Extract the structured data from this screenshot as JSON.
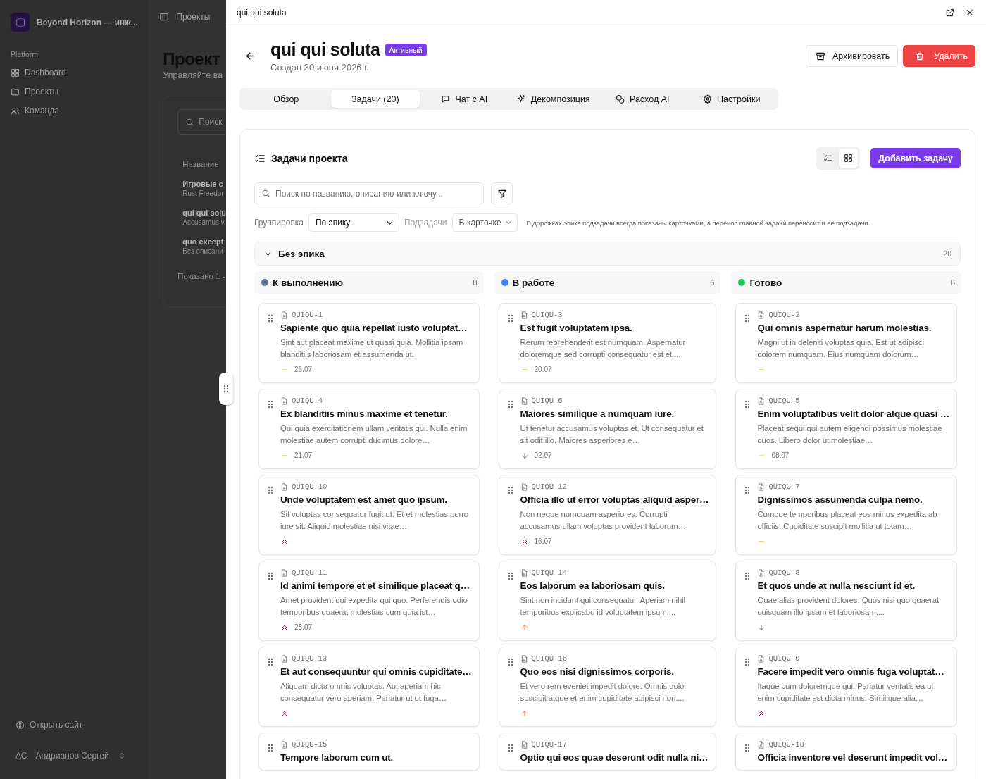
{
  "background": {
    "brand": "Beyond Horizon — инж...",
    "header_title": "Проекты",
    "section_label": "Platform",
    "nav": [
      {
        "label": "Dashboard"
      },
      {
        "label": "Проекты"
      },
      {
        "label": "Команда"
      }
    ],
    "open_site": "Открыть сайт",
    "user": {
      "initials": "АС",
      "name": "Андрианов Сергей"
    },
    "page_title": "Проект",
    "page_subtitle": "Управляйте ва",
    "search_placeholder": "Поиск",
    "column_header": "Название",
    "rows": [
      {
        "title": "Игровые с",
        "subtitle": "Rust Freedor"
      },
      {
        "title": "qui qui solu",
        "subtitle": "Accusamus v"
      },
      {
        "title": "quo except",
        "subtitle": "Без описани"
      }
    ],
    "footer": "Показано 1 -"
  },
  "drawer": {
    "title": "qui qui soluta"
  },
  "project": {
    "name": "qui qui soluta",
    "status": "Активный",
    "created": "Создан 30 июня 2026 г.",
    "archive_button": "Архивировать",
    "delete_button": "Удалить"
  },
  "tabs": [
    {
      "label": "Обзор",
      "selected": false
    },
    {
      "label": "Задачи (20)",
      "selected": true
    },
    {
      "label": "Чат с AI",
      "selected": false
    },
    {
      "label": "Декомпозиция",
      "selected": false
    },
    {
      "label": "Расход AI",
      "selected": false
    },
    {
      "label": "Настройки",
      "selected": false
    }
  ],
  "tasks_panel": {
    "title": "Задачи проекта",
    "views": [
      {
        "selected": false
      },
      {
        "selected": true
      }
    ],
    "add_button": "Добавить задачу",
    "search_placeholder": "Поиск по названию, описанию или ключу...",
    "grouping_label": "Группировка",
    "grouping_value": "По эпику",
    "subtasks_label": "Подзадачи",
    "subtasks_value": "В карточке",
    "hint": "В дорожках эпика подзадачи всегда показаны карточками, а перенос главной задачи переносит и её подзадачи.",
    "epic": {
      "name": "Без эпика",
      "count": "20",
      "expanded": true
    },
    "columns": [
      {
        "name": "К выполнению",
        "count": "8",
        "color": "#64748b",
        "cards": [
          {
            "key": "QUIQU-1",
            "title": "Sapiente quo quia repellat iusto voluptat…",
            "description": "Sint aut placeat maxime ut quasi quia. Mollitia ipsam blanditiis laboriosam et assumenda ut.",
            "kind": "medium",
            "date": "26.07"
          },
          {
            "key": "QUIQU-4",
            "title": "Ex blanditiis minus maxime et tenetur.",
            "description": "Qui quia exercitationem ullam veritatis qui. Nulla enim molestiae autem corrupti ducimus dolore…",
            "kind": "medium",
            "date": "21.07"
          },
          {
            "key": "QUIQU-10",
            "title": "Unde voluptatem est amet quo ipsum.",
            "description": "Sit voluptas consequatur fugit ut. Et et molestias porro iure sit. Aliquid molestiae nisi vitae…",
            "kind": "urgent"
          },
          {
            "key": "QUIQU-11",
            "title": "Id animi tempore et et similique placeat q…",
            "description": "Amet provident qui expedita qui quo. Perferendis odio temporibus quaerat molestias cum quia ist…",
            "kind": "urgent",
            "date": "28.07"
          },
          {
            "key": "QUIQU-13",
            "title": "Et aut consequuntur qui omnis cupiditate…",
            "description": "Aliquam dicta omnis voluptas. Aut aperiam hic consequatur vero aperiam. Pariatur ut ut fuga…",
            "kind": "urgent"
          },
          {
            "key": "QUIQU-15",
            "title": "Tempore laborum cum ut."
          }
        ]
      },
      {
        "name": "В работе",
        "count": "6",
        "color": "#3b82f6",
        "cards": [
          {
            "key": "QUIQU-3",
            "title": "Est fugit voluptatem ipsa.",
            "description": "Rerum reprehenderit est numquam. Aspernatur doloremque sed corrupti consequatur est et....",
            "kind": "medium",
            "date": "20.07"
          },
          {
            "key": "QUIQU-6",
            "title": "Maiores similique a numquam iure.",
            "description": "Ut tenetur accusamus voluptas et. Ut consequatur et sit odit illo. Maiores asperiores e…",
            "kind": "low",
            "date": "02.07"
          },
          {
            "key": "QUIQU-12",
            "title": "Officia illo ut error voluptas aliquid asper…",
            "description": "Non neque numquam asperiores. Corrupti accusamus ullam voluptas provident laborum…",
            "kind": "urgent",
            "date": "16.07"
          },
          {
            "key": "QUIQU-14",
            "title": "Eos laborum ea laboriosam quis.",
            "description": "Sint non incidunt qui consequatur. Aperiam nihil temporibus explicabo id voluptatem ipsum....",
            "kind": "high"
          },
          {
            "key": "QUIQU-16",
            "title": "Quo eos nisi dignissimos corporis.",
            "description": "Et vero rem eveniet impedit dolore. Omnis dolor suscipit atque et enim cupiditate adipisci non....",
            "kind": "high"
          },
          {
            "key": "QUIQU-17",
            "title": "Optio qui eos quae deserunt odit nulla ni…"
          }
        ]
      },
      {
        "name": "Готово",
        "count": "6",
        "color": "#22c55e",
        "cards": [
          {
            "key": "QUIQU-2",
            "title": "Qui omnis aspernatur harum molestias.",
            "description": "Magni ut in deleniti voluptas quia. Est ut adipisci dolorem numquam. Eius numquam dolorum…",
            "kind": "medium"
          },
          {
            "key": "QUIQU-5",
            "title": "Enim voluptatibus velit dolor atque quasi …",
            "description": "Placeat sequi qui autem eligendi possimus molestiae quos. Libero dolor ut molestiae…",
            "kind": "medium",
            "date": "08.07"
          },
          {
            "key": "QUIQU-7",
            "title": "Dignissimos assumenda culpa nemo.",
            "description": "Cumque temporibus placeat eos minus expedita ab officiis. Cupiditate suscipit mollitia ut totam…",
            "kind": "medium"
          },
          {
            "key": "QUIQU-8",
            "title": "Et quos unde at nulla nesciunt id et.",
            "description": "Quae alias provident dolores. Quos nisi quo quaerat quisquam illo ipsam et laboriosam....",
            "kind": "low"
          },
          {
            "key": "QUIQU-9",
            "title": "Facere impedit vero omnis fuga voluptat…",
            "description": "Itaque cum doloremque qui. Pariatur veritatis ea ut enim cupiditate est dicta minus. Similique alia…",
            "kind": "urgent"
          },
          {
            "key": "QUIQU-18",
            "title": "Officia inventore vel deserunt impedit vol…"
          }
        ]
      }
    ]
  }
}
